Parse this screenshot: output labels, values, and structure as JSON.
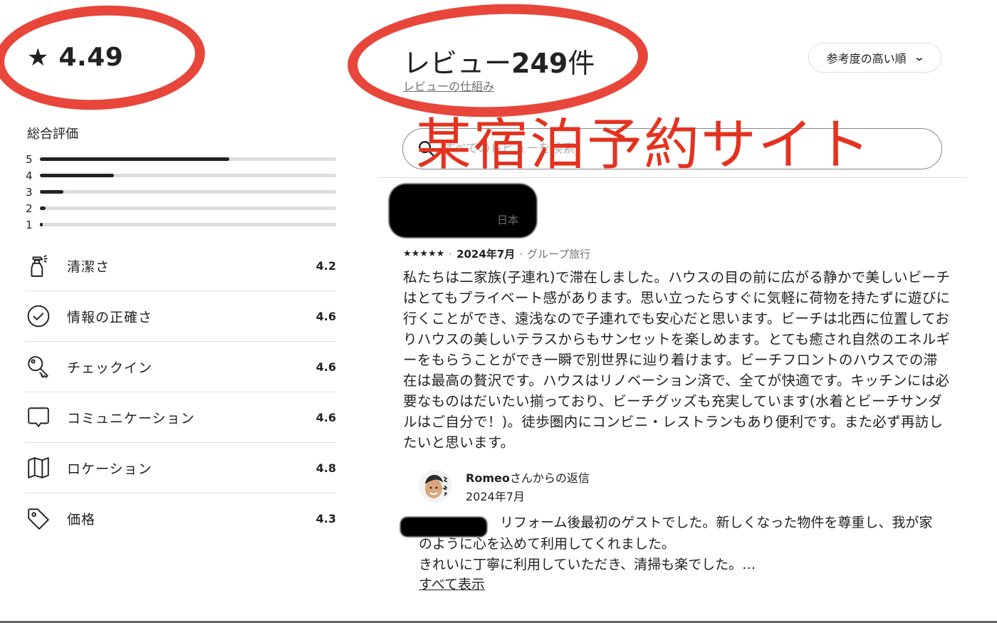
{
  "rating": {
    "star_icon": "star-icon",
    "score": "4.49"
  },
  "overall": {
    "label": "総合評価",
    "distribution": [
      {
        "stars": "5",
        "fraction": 0.64
      },
      {
        "stars": "4",
        "fraction": 0.25
      },
      {
        "stars": "3",
        "fraction": 0.08
      },
      {
        "stars": "2",
        "fraction": 0.02
      },
      {
        "stars": "1",
        "fraction": 0.01
      }
    ]
  },
  "categories": [
    {
      "icon": "spray-bottle-icon",
      "label": "清潔さ",
      "value": "4.2"
    },
    {
      "icon": "check-circle-icon",
      "label": "情報の正確さ",
      "value": "4.6"
    },
    {
      "icon": "key-icon",
      "label": "チェックイン",
      "value": "4.6"
    },
    {
      "icon": "chat-bubble-icon",
      "label": "コミュニケーション",
      "value": "4.6"
    },
    {
      "icon": "map-icon",
      "label": "ロケーション",
      "value": "4.8"
    },
    {
      "icon": "price-tag-icon",
      "label": "価格",
      "value": "4.3"
    }
  ],
  "reviews_header": {
    "title_prefix": "レビュー",
    "count": "249",
    "title_suffix": "件",
    "how_link": "レビューの仕組み"
  },
  "sort": {
    "label": "参考度の高い順",
    "icon": "chevron-down-icon"
  },
  "search": {
    "placeholder": "すべてのレビューを検索",
    "icon": "search-icon"
  },
  "review": {
    "reviewer_location": "日本",
    "stars": "★★★★★",
    "date": "2024年7月",
    "trip_type": "グループ旅行",
    "body": "私たちは二家族(子連れ)で滞在しました。ハウスの目の前に広がる静かで美しいビーチはとてもプライベート感があります。思い立ったらすぐに気軽に荷物を持たずに遊びに行くことができ、遠浅なので子連れでも安心だと思います。ビーチは北西に位置しておりハウスの美しいテラスからもサンセットを楽しめます。とても癒され自然のエネルギーをもらうことができ一瞬で別世界に辿り着けます。ビーチフロントのハウスでの滞在は最高の贅沢です。ハウスはリノベーション済で、全てが快適です。キッチンには必要なものはだいたい揃っており、ビーチグッズも充実しています(水着とビーチサンダルはご自分で！)。徒歩圏内にコンビニ・レストランもあり便利です。また必ず再訪したいと思います。"
  },
  "host_reply": {
    "host_name": "Romeo",
    "reply_suffix": "さんからの返信",
    "date": "2024年7月",
    "body_line1": "　　　　　　リフォーム後最初のゲストでした。新しくなった物件を尊重し、我が家のように心を込めて利用してくれました。",
    "body_line2": "きれいに丁寧に利用していただき、清掃も楽でした。…",
    "show_all": "すべて表示"
  },
  "annotation": {
    "text": "某宿泊予約サイト",
    "color": "#e3321f"
  },
  "colors": {
    "text": "#222222",
    "muted": "#717171",
    "divider": "#dddddd",
    "annotation_red": "#e8463a"
  }
}
